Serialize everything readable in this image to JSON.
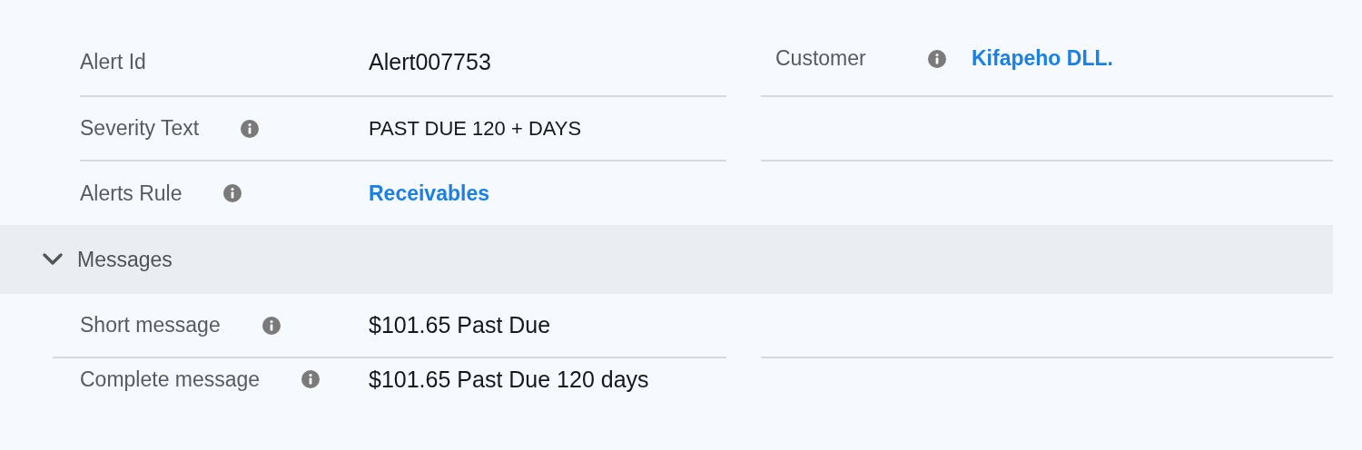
{
  "fields": [
    {
      "label": "Alert Id",
      "info": false,
      "value": "Alert007753",
      "kind": "text"
    },
    {
      "label": "Severity Text",
      "info": true,
      "value": "PAST DUE 120 + DAYS",
      "kind": "caps"
    },
    {
      "label": "Alerts Rule",
      "info": true,
      "value": "Receivables",
      "kind": "link"
    }
  ],
  "customer": {
    "label": "Customer",
    "info": true,
    "value": "Kifapeho DLL.",
    "kind": "link"
  },
  "section": {
    "title": "Messages",
    "expanded": true
  },
  "messages": [
    {
      "label": "Short message",
      "info": true,
      "value": "$101.65 Past Due"
    },
    {
      "label": "Complete message",
      "info": true,
      "value": "$101.65 Past Due 120 days"
    }
  ]
}
